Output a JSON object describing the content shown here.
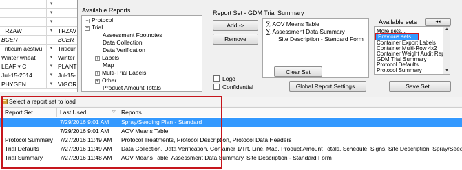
{
  "grid": {
    "rows": [
      {
        "c1": "",
        "c2": "▾",
        "c3": ""
      },
      {
        "c1": "",
        "c2": "▾",
        "c3": ""
      },
      {
        "c1": "",
        "c2": "▾",
        "c3": ""
      },
      {
        "c1": "TRZAW",
        "c2": "▾",
        "c3": "TRZAV"
      },
      {
        "c1": "BCER",
        "c2": "",
        "c3": "BCER"
      },
      {
        "c1": "Triticum aestivu",
        "c2": "▾",
        "c3": "Triticur"
      },
      {
        "c1": "Winter wheat",
        "c2": "▾",
        "c3": "Winter"
      },
      {
        "c1": "LEAF  ▾ C",
        "c2": "▾",
        "c3": "PLANT"
      },
      {
        "c1": "Jul-15-2014",
        "c2": "▾",
        "c3": "Jul-15-"
      },
      {
        "c1": "PHYGEN",
        "c2": "▾",
        "c3": "VIGOR"
      }
    ]
  },
  "available_reports": {
    "title": "Available Reports",
    "items": [
      {
        "label": "Protocol",
        "expander": "+"
      },
      {
        "label": "Trial",
        "expander": "−"
      },
      {
        "label": "Assessment Footnotes",
        "expander": ""
      },
      {
        "label": "Data Collection",
        "expander": ""
      },
      {
        "label": "Data Verification",
        "expander": ""
      },
      {
        "label": "Labels",
        "expander": "+"
      },
      {
        "label": "Map",
        "expander": ""
      },
      {
        "label": "Multi-Trial Labels",
        "expander": "+"
      },
      {
        "label": "Other",
        "expander": "+"
      },
      {
        "label": "Product Amount Totals",
        "expander": ""
      }
    ]
  },
  "report_set": {
    "title": "Report Set - GDM Trial Summary",
    "add_label": "Add ->",
    "remove_label": "Remove",
    "clear_label": "Clear Set",
    "items": [
      {
        "label": "AOV Means Table",
        "sigma": "∑"
      },
      {
        "label": "Assessment Data Summary",
        "sigma": "∑"
      },
      {
        "label": "Site Description - Standard Form",
        "sigma": ""
      }
    ],
    "logo_label": "Logo",
    "confidential_label": "Confidential",
    "global_settings_label": "Global Report Settings..."
  },
  "available_sets": {
    "title": "Available sets",
    "collapse_label": "◂◂",
    "items": [
      {
        "label": "More sets...",
        "selected": false
      },
      {
        "label": "Previous sets...",
        "selected": true
      },
      {
        "label": "Container Export Labels",
        "selected": false
      },
      {
        "label": "Container Multi-Row 4x2",
        "selected": false
      },
      {
        "label": "Container Weight Audit Rep",
        "selected": false
      },
      {
        "label": "GDM Trial Summary",
        "selected": false
      },
      {
        "label": "Protocol Defaults",
        "selected": false
      },
      {
        "label": "Protocol Summary",
        "selected": false
      }
    ],
    "save_label": "Save Set..."
  },
  "load_panel": {
    "title": "Select a report set to load",
    "columns": {
      "set": "Report Set",
      "date": "Last Used",
      "reports": "Reports"
    },
    "rows": [
      {
        "set": "",
        "date": "7/29/2016 9:01 AM",
        "reports": "Spray/Seeding Plan - Standard",
        "selected": true
      },
      {
        "set": "",
        "date": "7/29/2016 9:01 AM",
        "reports": "AOV Means Table",
        "selected": false
      },
      {
        "set": "Protocol Summary",
        "date": "7/27/2016 11:49 AM",
        "reports": "Protocol Treatments, Protocol Description, Protocol Data Headers",
        "selected": false
      },
      {
        "set": "Trial Defaults",
        "date": "7/27/2016 11:49 AM",
        "reports": "Data Collection, Data Verification, Container 1/Trt. Line, Map, Product Amount Totals, Schedule, Signs, Site Description, Spray/Seeding Plan -",
        "selected": false
      },
      {
        "set": "Trial Summary",
        "date": "7/27/2016 11:48 AM",
        "reports": "AOV Means Table, Assessment Data Summary, Site Description - Standard Form",
        "selected": false
      }
    ]
  },
  "colors": {
    "selection": "#3399ff",
    "callout": "#c6161d"
  }
}
